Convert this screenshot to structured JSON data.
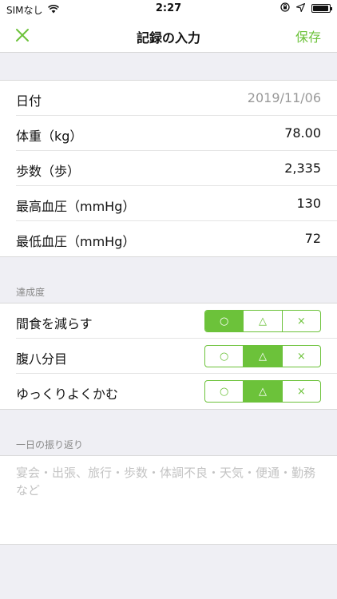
{
  "status_bar": {
    "carrier": "SIMなし",
    "time": "2:27"
  },
  "nav": {
    "title": "記録の入力",
    "save_label": "保存"
  },
  "records": [
    {
      "label": "日付",
      "value": "2019/11/06"
    },
    {
      "label": "体重（kg）",
      "value": "78.00"
    },
    {
      "label": "歩数（歩）",
      "value": "2,335"
    },
    {
      "label": "最高血圧（mmHg）",
      "value": "130"
    },
    {
      "label": "最低血圧（mmHg）",
      "value": "72"
    }
  ],
  "achievement": {
    "title": "達成度",
    "options": [
      "○",
      "△",
      "×"
    ],
    "items": [
      {
        "label": "間食を減らす",
        "selected": "○"
      },
      {
        "label": "腹八分目",
        "selected": "△"
      },
      {
        "label": "ゆっくりよくかむ",
        "selected": "△"
      }
    ]
  },
  "reflection": {
    "title": "一日の振り返り",
    "placeholder": "宴会・出張、旅行・歩数・体調不良・天気・便通・勤務など",
    "value": ""
  },
  "colors": {
    "accent": "#6cc23a",
    "background": "#efeff4"
  }
}
